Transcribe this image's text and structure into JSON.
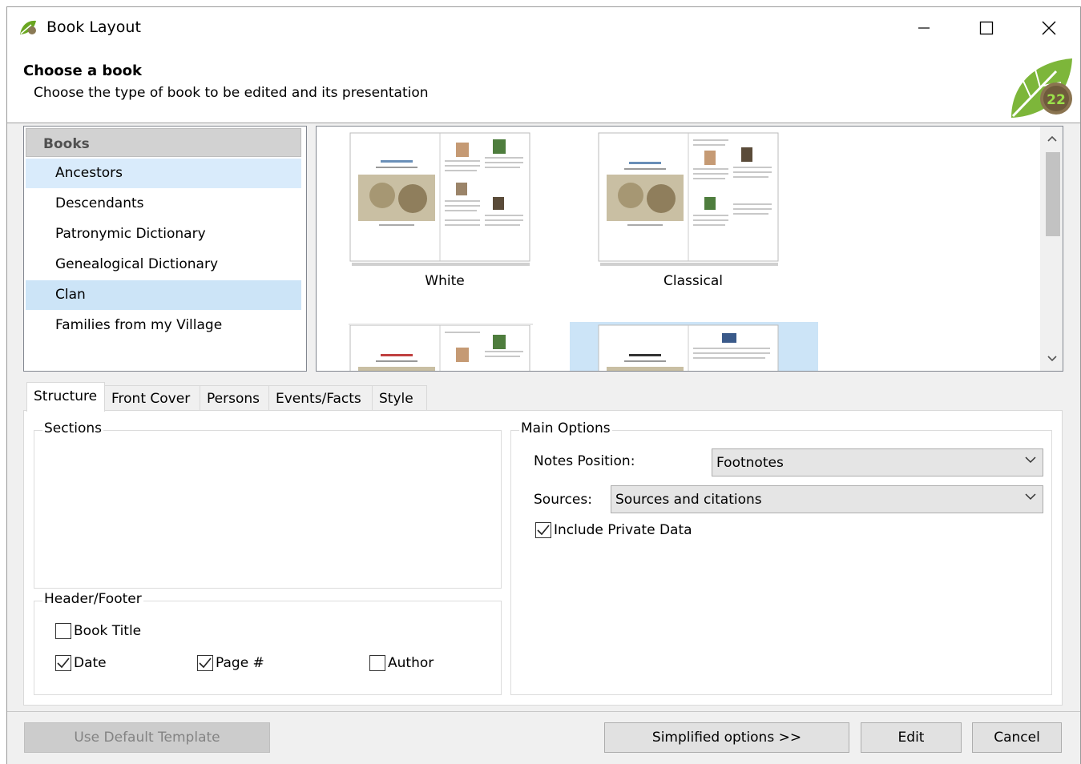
{
  "window": {
    "title": "Book Layout",
    "controls": {
      "minimize": "—",
      "maximize": "☐",
      "close": "✕"
    }
  },
  "header": {
    "title": "Choose a book",
    "subtitle": "Choose the type of book to be edited and its presentation",
    "logo_text": "22"
  },
  "books": {
    "heading": "Books",
    "items": [
      {
        "label": "Ancestors",
        "state": "highlighted"
      },
      {
        "label": "Descendants",
        "state": ""
      },
      {
        "label": "Patronymic Dictionary",
        "state": ""
      },
      {
        "label": "Genealogical Dictionary",
        "state": ""
      },
      {
        "label": "Clan",
        "state": "selected"
      },
      {
        "label": "Families from my Village",
        "state": ""
      }
    ]
  },
  "styles": {
    "items": [
      {
        "label": "White"
      },
      {
        "label": "Classical"
      }
    ]
  },
  "tabs": [
    "Structure",
    "Front Cover",
    "Persons",
    "Events/Facts",
    "Style"
  ],
  "structure": {
    "sections_label": "Sections",
    "header_footer_label": "Header/Footer",
    "book_title": {
      "label": "Book Title",
      "checked": false
    },
    "date": {
      "label": "Date",
      "checked": true
    },
    "page_num": {
      "label": "Page #",
      "checked": true
    },
    "author": {
      "label": "Author",
      "checked": false
    },
    "main_options_label": "Main Options",
    "notes_position_label": "Notes Position:",
    "notes_position_value": "Footnotes",
    "sources_label": "Sources:",
    "sources_value": "Sources and citations",
    "include_private": {
      "label": "Include Private Data",
      "checked": true
    }
  },
  "buttons": {
    "use_default": "Use Default Template",
    "simplified": "Simplified options >>",
    "edit": "Edit",
    "cancel": "Cancel"
  },
  "colors": {
    "selection": "#cce4f7",
    "highlight": "#d9ebfb",
    "logo_green": "#6aa621"
  }
}
